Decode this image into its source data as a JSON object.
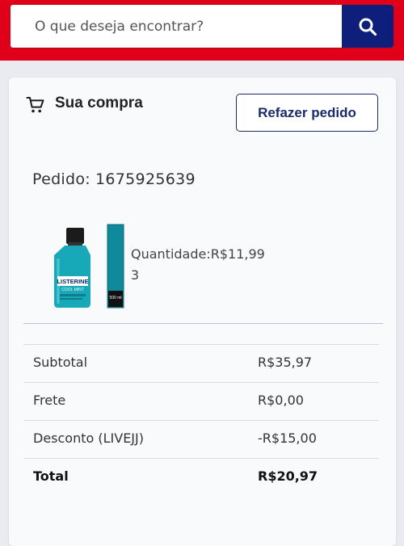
{
  "header": {
    "search_placeholder": "O que deseja encontrar?",
    "colors": {
      "bar": "#e1001a",
      "button": "#0d1f7a"
    }
  },
  "card": {
    "title": "Sua compra",
    "redo_label": "Refazer pedido",
    "order_label": "Pedido:",
    "order_number": "1675925639"
  },
  "product": {
    "image_icon": "listerine-bottle-icon",
    "image_brand_text": "LISTERINE",
    "image_variant_text": "COOL MINT",
    "image_volume_text": "500 ml",
    "quantity_label": "Quantidade:",
    "quantity": "3",
    "price": "R$11,99"
  },
  "summary": [
    {
      "label": "Subtotal",
      "value": "R$35,97"
    },
    {
      "label": "Frete",
      "value": "R$0,00"
    },
    {
      "label": "Desconto (LIVEJJ)",
      "value": "-R$15,00"
    },
    {
      "label": "Total",
      "value": "R$20,97"
    }
  ]
}
